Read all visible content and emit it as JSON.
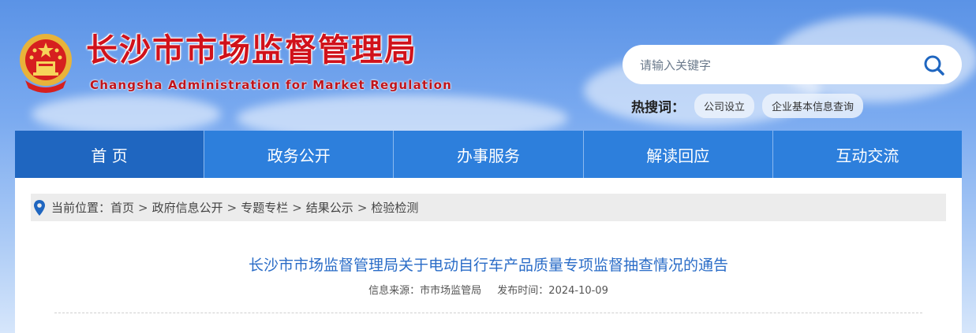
{
  "header": {
    "title": "长沙市市场监督管理局",
    "subtitle": "Changsha Administration for Market Regulation",
    "search_placeholder": "请输入关键字",
    "hot_label": "热搜词：",
    "hot_tags": [
      "公司设立",
      "企业基本信息查询"
    ]
  },
  "nav": [
    "首 页",
    "政务公开",
    "办事服务",
    "解读回应",
    "互动交流"
  ],
  "breadcrumb": {
    "prefix": "当前位置：",
    "items": [
      "首页",
      "政府信息公开",
      "专题专栏",
      "结果公示",
      "检验检测"
    ],
    "separator": ">"
  },
  "article": {
    "title": "长沙市市场监督管理局关于电动自行车产品质量专项监督抽查情况的通告",
    "source": "信息来源：市市场监管局",
    "date": "发布时间：2024-10-09"
  },
  "colors": {
    "nav": "#2d7fdc",
    "nav_active": "#1f66c0",
    "title_red": "#d0121b",
    "link_blue": "#2a6cc7"
  }
}
